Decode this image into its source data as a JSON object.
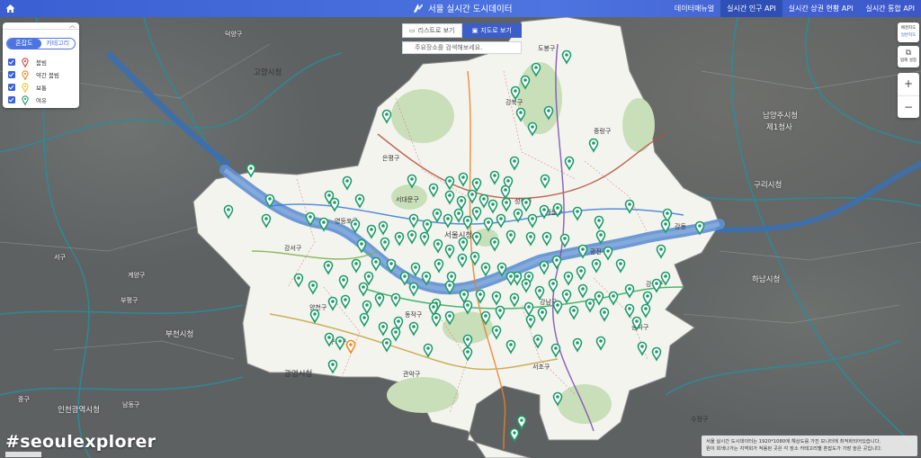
{
  "header": {
    "title": "서울 실시간 도시데이터",
    "nav": [
      {
        "label": "데이터매뉴얼",
        "active": false
      },
      {
        "label": "실시간 인구 API",
        "active": true
      },
      {
        "label": "실시간 상권 현황 API",
        "active": false
      },
      {
        "label": "실시간 통합 API",
        "active": false
      }
    ]
  },
  "view_toggle": {
    "list_label": "리스트로 보기",
    "map_label": "지도로 보기",
    "active": "map"
  },
  "search": {
    "placeholder": "주요장소를 검색해보세요."
  },
  "legend": {
    "tabs": [
      {
        "label": "혼잡도",
        "active": true
      },
      {
        "label": "카테고리",
        "active": false
      }
    ],
    "items": [
      {
        "label": "붐빔",
        "color": "#e0413c"
      },
      {
        "label": "약간 붐빔",
        "color": "#f08a24"
      },
      {
        "label": "보통",
        "color": "#f2c523"
      },
      {
        "label": "여유",
        "color": "#1f9b6b"
      }
    ]
  },
  "controls": {
    "layer_label": "배경지도",
    "layer_value": "일반지도",
    "legend_label": "범례 설정",
    "zoom_in": "+",
    "zoom_out": "−"
  },
  "hashtag": "#seoulexplorer",
  "notice": [
    "서울 실시간 도시데이터는 1920*1080에 해상도를 가진 모니터에 최적화되어있습니다.",
    "원이 회색나가는 지역회가 적용된 곳은 각 장소 카테고리별 혼잡도가 가장 높은 곳입니다."
  ],
  "map_labels": [
    {
      "text": "고양시청",
      "kind": "city"
    },
    {
      "text": "남양주시청",
      "kind": "city"
    },
    {
      "text": "제1청사",
      "kind": "city"
    },
    {
      "text": "구리시청",
      "kind": "city"
    },
    {
      "text": "하남시청",
      "kind": "city"
    },
    {
      "text": "부천시청",
      "kind": "city"
    },
    {
      "text": "광명시청",
      "kind": "city"
    },
    {
      "text": "인천광역시청",
      "kind": "city"
    },
    {
      "text": "서울시청",
      "kind": "city"
    },
    {
      "text": "은평구",
      "kind": "gu"
    },
    {
      "text": "서대문구",
      "kind": "gu"
    },
    {
      "text": "강서구",
      "kind": "gu"
    },
    {
      "text": "양천구",
      "kind": "gu"
    },
    {
      "text": "구로구",
      "kind": "gu"
    },
    {
      "text": "관악구",
      "kind": "gu"
    },
    {
      "text": "동작구",
      "kind": "gu"
    },
    {
      "text": "강남구",
      "kind": "gu"
    },
    {
      "text": "서초구",
      "kind": "gu"
    },
    {
      "text": "송파구",
      "kind": "gu"
    },
    {
      "text": "강동구",
      "kind": "gu"
    },
    {
      "text": "광진구",
      "kind": "gu"
    },
    {
      "text": "중랑구",
      "kind": "gu"
    },
    {
      "text": "강북구",
      "kind": "gu"
    },
    {
      "text": "성북구",
      "kind": "gu"
    },
    {
      "text": "동대문구",
      "kind": "gu"
    },
    {
      "text": "영등포구",
      "kind": "gu"
    },
    {
      "text": "도봉구",
      "kind": "gu"
    },
    {
      "text": "계양구",
      "kind": "gu"
    },
    {
      "text": "서구",
      "kind": "gu"
    },
    {
      "text": "부평구",
      "kind": "gu"
    },
    {
      "text": "남동구",
      "kind": "gu"
    },
    {
      "text": "중구",
      "kind": "gu"
    },
    {
      "text": "강동",
      "kind": "gu"
    },
    {
      "text": "수정구",
      "kind": "gu"
    },
    {
      "text": "덕양구",
      "kind": "gu"
    }
  ],
  "marker_count": 170
}
